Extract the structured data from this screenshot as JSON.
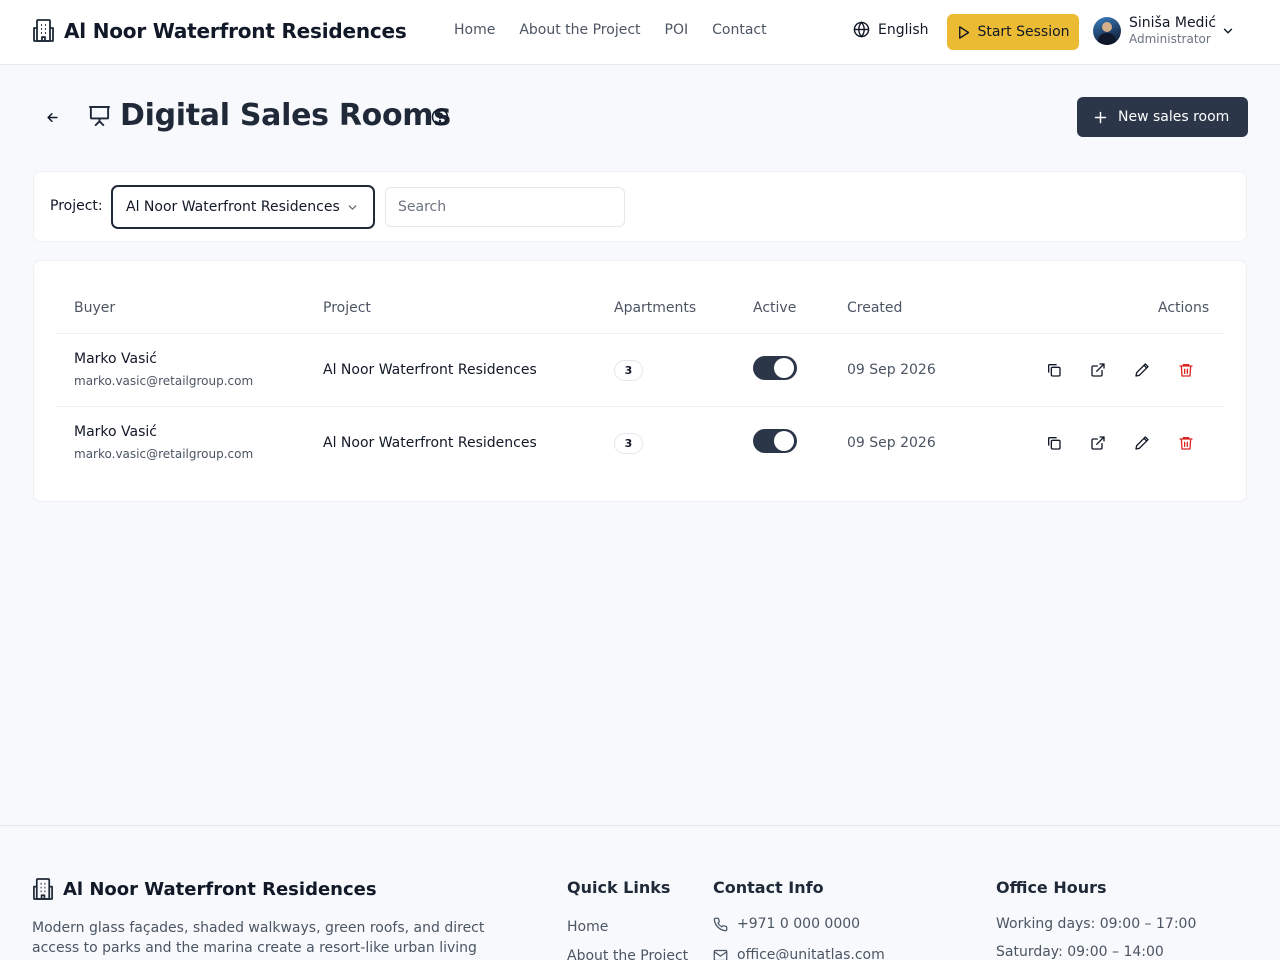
{
  "header": {
    "brand": "Al Noor Waterfront Residences",
    "nav": [
      "Home",
      "About the Project",
      "POI",
      "Contact"
    ],
    "language": "English",
    "start_session": "Start Session",
    "user": {
      "name": "Siniša Medić",
      "role": "Administrator"
    }
  },
  "page": {
    "title": "Digital Sales Rooms",
    "new_button": "New sales room"
  },
  "filters": {
    "project_label": "Project:",
    "project_value": "Al Noor Waterfront Residences",
    "search_placeholder": "Search"
  },
  "table": {
    "columns": {
      "buyer": "Buyer",
      "project": "Project",
      "apartments": "Apartments",
      "active": "Active",
      "created": "Created",
      "actions": "Actions"
    },
    "rows": [
      {
        "buyer_name": "Marko Vasić",
        "buyer_email": "marko.vasic@retailgroup.com",
        "project": "Al Noor Waterfront Residences",
        "apartments": "3",
        "active": true,
        "created": "09 Sep 2026"
      },
      {
        "buyer_name": "Marko Vasić",
        "buyer_email": "marko.vasic@retailgroup.com",
        "project": "Al Noor Waterfront Residences",
        "apartments": "3",
        "active": true,
        "created": "09 Sep 2026"
      }
    ]
  },
  "footer": {
    "brand": "Al Noor Waterfront Residences",
    "description": "Modern glass façades, shaded walkways, green roofs, and direct access to parks and the marina create a resort-like urban living experience.",
    "quick_links_title": "Quick Links",
    "quick_links": [
      "Home",
      "About the Project"
    ],
    "contact_title": "Contact Info",
    "phone": "+971 0 000 0000",
    "email": "office@unitatlas.com",
    "hours_title": "Office Hours",
    "hours": [
      "Working days: 09:00 – 17:00",
      "Saturday: 09:00 – 14:00"
    ]
  },
  "colors": {
    "accent_yellow": "#ebbb34",
    "primary_dark": "#2b3648",
    "danger": "#dc2626"
  },
  "icons": {
    "brand": "building-icon",
    "language": "globe-icon",
    "start": "play-icon",
    "title": "presentation-icon",
    "help": "help-circle-icon",
    "actions": [
      "copy-icon",
      "external-link-icon",
      "edit-icon",
      "trash-icon"
    ]
  }
}
